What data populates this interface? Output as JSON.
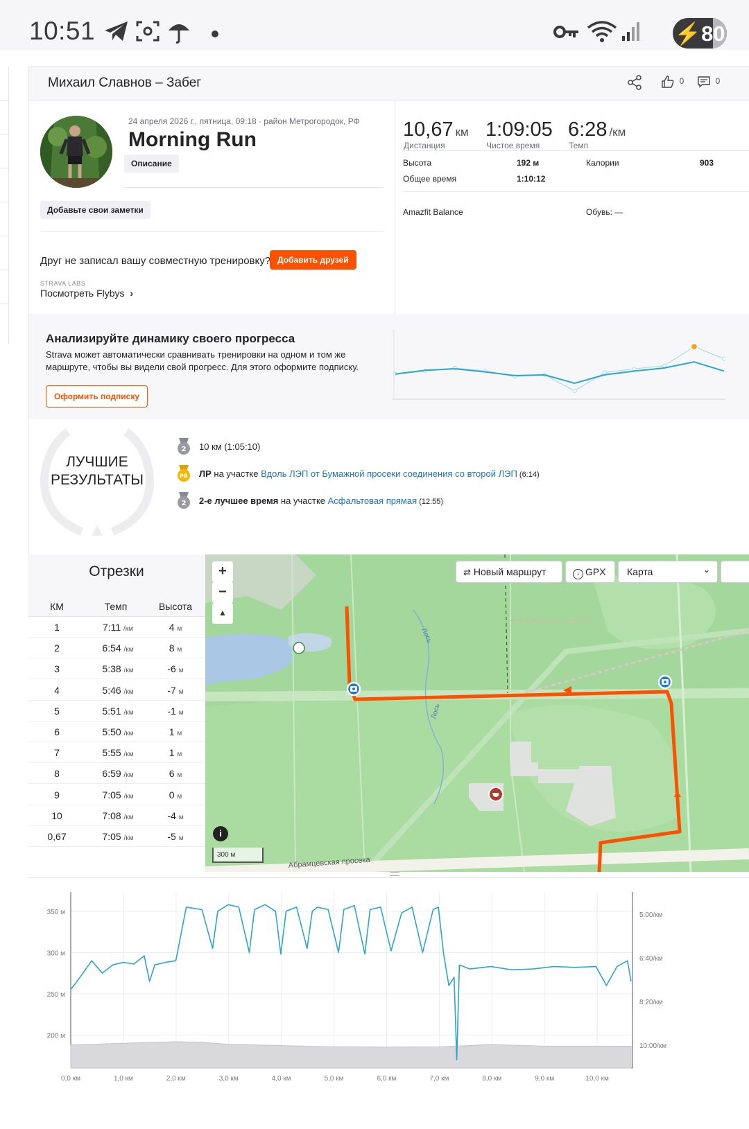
{
  "status_bar": {
    "time": "10:51",
    "battery": "80"
  },
  "header": {
    "title": "Михаил Славнов – Забег",
    "kudos_count": "0",
    "comments_count": "0"
  },
  "activity": {
    "date_location": "24 апреля 2026 г., пятница, 09:18 · район Метрогородок, РФ",
    "title": "Morning Run",
    "description_chip": "Описание",
    "notes_chip": "Добавьте свои заметки",
    "friend_prompt": "Друг не записал вашу совместную тренировку?",
    "add_friends_button": "Добавить друзей",
    "labs_label": "STRAVA LABS",
    "flybys_link": "Посмотреть Flybys"
  },
  "stats": {
    "distance_value": "10,67",
    "distance_unit": "км",
    "distance_label": "Дистанция",
    "moving_time_value": "1:09:05",
    "moving_time_label": "Чистое время",
    "pace_value": "6:28",
    "pace_unit": "/км",
    "pace_label": "Темп",
    "elevation_label": "Высота",
    "elevation_value": "192 м",
    "elapsed_label": "Общее время",
    "elapsed_value": "1:10:12",
    "calories_label": "Калории",
    "calories_value": "903",
    "device": "Amazfit Balance",
    "shoes": "Обувь: —"
  },
  "analyze": {
    "title": "Анализируйте динамику своего прогресса",
    "text": "Strava может автоматически сравнивать тренировки на одном и том же маршруте, чтобы вы видели свой прогресс. Для этого оформите подписку.",
    "subscribe_button": "Оформить подписку",
    "trend_values": [
      32,
      37,
      39,
      35,
      30,
      31,
      20,
      31,
      36,
      40,
      48,
      36
    ],
    "trend_secondary_values": [
      32,
      36,
      40,
      36,
      29,
      31,
      10,
      34,
      39,
      43,
      68,
      52
    ]
  },
  "best_results": {
    "title_line1": "ЛУЧШИЕ",
    "title_line2": "РЕЗУЛЬТАТЫ",
    "items": [
      {
        "medal": "2",
        "bold": "",
        "text": "10 км  (1:05:10)",
        "link": "",
        "time": ""
      },
      {
        "medal": "PR",
        "bold": "ЛР",
        "text": " на участке ",
        "link": "Вдоль ЛЭП от Бумажной просеки соединения со второй ЛЭП",
        "time": " (6:14)"
      },
      {
        "medal": "2",
        "bold": "2-е лучшее время",
        "text": " на участке ",
        "link": "Асфальтовая прямая",
        "time": " (12:55)"
      }
    ]
  },
  "splits": {
    "title": "Отрезки",
    "col_km": "КМ",
    "col_pace": "Темп",
    "col_elev": "Высота",
    "pace_unit": "/км",
    "elev_unit": "м",
    "rows": [
      {
        "km": "1",
        "pace": "7:11",
        "elev": "4"
      },
      {
        "km": "2",
        "pace": "6:54",
        "elev": "8"
      },
      {
        "km": "3",
        "pace": "5:38",
        "elev": "-6"
      },
      {
        "km": "4",
        "pace": "5:46",
        "elev": "-7"
      },
      {
        "km": "5",
        "pace": "5:51",
        "elev": "-1"
      },
      {
        "km": "6",
        "pace": "5:50",
        "elev": "1"
      },
      {
        "km": "7",
        "pace": "5:55",
        "elev": "1"
      },
      {
        "km": "8",
        "pace": "6:59",
        "elev": "6"
      },
      {
        "km": "9",
        "pace": "7:05",
        "elev": "0"
      },
      {
        "km": "10",
        "pace": "7:08",
        "elev": "-4"
      },
      {
        "km": "0,67",
        "pace": "7:05",
        "elev": "-5"
      }
    ]
  },
  "map": {
    "new_route_button": "Новый маршрут",
    "gpx_button": "GPX",
    "map_type_select": "Карта",
    "scale_label": "300 м",
    "road_label": "Абрамцевская просека",
    "river_label": "Лось",
    "route_color": "#fc5200"
  },
  "chart_data": {
    "type": "line",
    "x_unit": "км",
    "x_ticks": [
      "0,0 км",
      "1,0 км",
      "2,0 км",
      "3,0 км",
      "4,0 км",
      "5,0 км",
      "6,0 км",
      "7,0 км",
      "8,0 км",
      "9,0 км",
      "10,0 км"
    ],
    "left_axis": {
      "ticks": [
        "350 м",
        "300 м",
        "250 м",
        "200 м"
      ],
      "tick_values": [
        350,
        300,
        250,
        200
      ],
      "range": [
        160,
        370
      ]
    },
    "right_axis": {
      "ticks": [
        "5:00/км",
        "6:40/км",
        "8:20/км",
        "10:00/км"
      ]
    },
    "series": [
      {
        "x": [
          0.0,
          0.2,
          0.4,
          0.6,
          0.8,
          1.0,
          1.2,
          1.4,
          1.5,
          1.6,
          1.8,
          2.0,
          2.2,
          2.5,
          2.7,
          2.8,
          3.0,
          3.2,
          3.4,
          3.5,
          3.7,
          3.9,
          4.0,
          4.1,
          4.3,
          4.5,
          4.6,
          4.7,
          4.9,
          5.1,
          5.2,
          5.4,
          5.6,
          5.7,
          5.9,
          6.1,
          6.3,
          6.5,
          6.7,
          6.9,
          7.0,
          7.1,
          7.2,
          7.3,
          7.35,
          7.4,
          7.6,
          8.0,
          8.4,
          8.8,
          9.2,
          9.6,
          10.0,
          10.2,
          10.4,
          10.6,
          10.67
        ],
        "values": [
          255,
          272,
          290,
          275,
          285,
          288,
          286,
          296,
          265,
          285,
          288,
          290,
          355,
          352,
          305,
          350,
          358,
          355,
          300,
          352,
          358,
          350,
          298,
          350,
          355,
          305,
          350,
          355,
          352,
          300,
          352,
          357,
          298,
          352,
          355,
          302,
          348,
          355,
          300,
          352,
          355,
          298,
          260,
          270,
          170,
          285,
          280,
          283,
          279,
          280,
          283,
          282,
          283,
          260,
          283,
          290,
          265
        ]
      },
      {
        "x": [
          0.0,
          1.0,
          2.0,
          2.5,
          3.0,
          4.0,
          5.0,
          6.0,
          7.0,
          8.0,
          9.0,
          10.0,
          10.67
        ],
        "values": [
          188,
          190,
          192,
          191,
          189,
          187,
          186,
          185,
          186,
          188,
          187,
          186,
          187
        ]
      }
    ],
    "grid": true,
    "legend": "none"
  }
}
